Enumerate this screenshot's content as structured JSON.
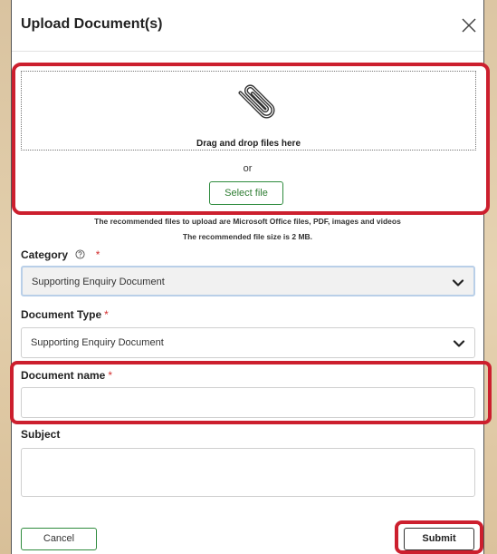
{
  "modal": {
    "title": "Upload Document(s)",
    "close_icon": "close-icon"
  },
  "upload": {
    "icon": "paperclip-icon",
    "drop_text": "Drag and drop files here",
    "or_text": "or",
    "select_label": "Select file",
    "recommend_types": "The recommended files to upload are Microsoft Office files, PDF, images and videos",
    "recommend_size": "The recommended file size is 2 MB."
  },
  "form": {
    "category": {
      "label": "Category",
      "required_mark": "*",
      "help_icon": "help-circle-icon",
      "value": "Supporting Enquiry Document"
    },
    "document_type": {
      "label": "Document Type",
      "required_mark": "*",
      "value": "Supporting Enquiry Document"
    },
    "document_name": {
      "label": "Document name",
      "required_mark": "*",
      "value": ""
    },
    "subject": {
      "label": "Subject",
      "value": ""
    }
  },
  "actions": {
    "cancel_label": "Cancel",
    "submit_label": "Submit"
  },
  "colors": {
    "highlight": "#cc1f2e",
    "accent_green": "#2e8b3d",
    "required": "#d32f2f"
  }
}
